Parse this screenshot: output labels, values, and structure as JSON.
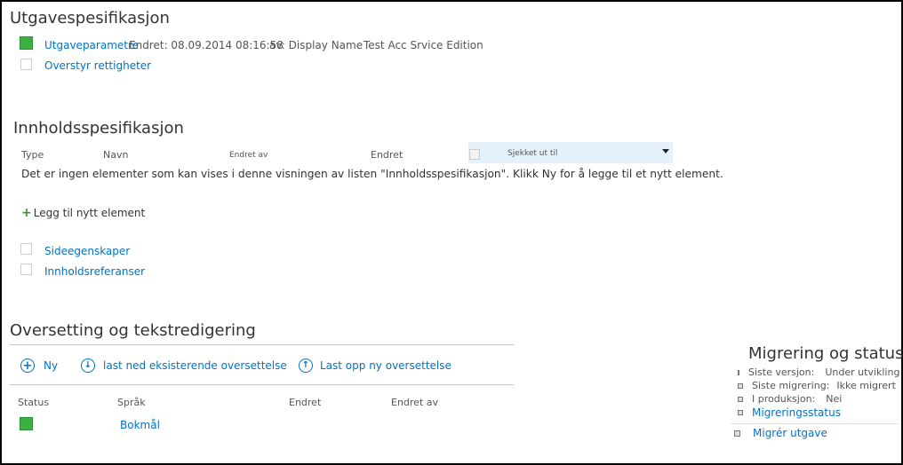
{
  "sections": {
    "edition": {
      "title": "Utgavespesifikasjon",
      "params_link": "Utgaveparametre",
      "modified": "Endret: 08.09.2014 08:16:58",
      "by": "av: Display Name",
      "edition_name": "Test Acc Srvice Edition",
      "override_link": "Overstyr rettigheter"
    },
    "content": {
      "title": "Innholdsspesifikasjon",
      "columns": {
        "type": "Type",
        "name": "Navn",
        "modified_by": "Endret av",
        "modified": "Endret",
        "checked_out": "Sjekket ut til"
      },
      "empty_message": "Det er ingen elementer som kan vises i denne visningen av listen \"Innholdsspesifikasjon\". Klikk Ny for å legge til et nytt element.",
      "add_new": "Legg til nytt element",
      "page_props_link": "Sideegenskaper",
      "content_refs_link": "Innholdsreferanser"
    },
    "translation": {
      "title": "Oversetting og tekstredigering",
      "new_label": "Ny",
      "download_label": "last ned eksisterende oversettelse",
      "upload_label": "Last opp ny oversettelse",
      "columns": {
        "status": "Status",
        "language": "Språk",
        "modified": "Endret",
        "modified_by": "Endret av"
      },
      "rows": [
        {
          "language": "Bokmål"
        }
      ]
    },
    "migration": {
      "title": "Migrering og status",
      "items": [
        {
          "label": "Siste versjon:",
          "value": "Under utvikling"
        },
        {
          "label": "Siste migrering:",
          "value": "Ikke migrert"
        },
        {
          "label": "I produksjon:",
          "value": "Nei"
        }
      ],
      "status_link": "Migreringsstatus",
      "migrate_link": "Migrér utgave"
    }
  },
  "colors": {
    "link": "#0072c6",
    "status_green": "#3cb043",
    "header_highlight": "#e5f1fb"
  }
}
